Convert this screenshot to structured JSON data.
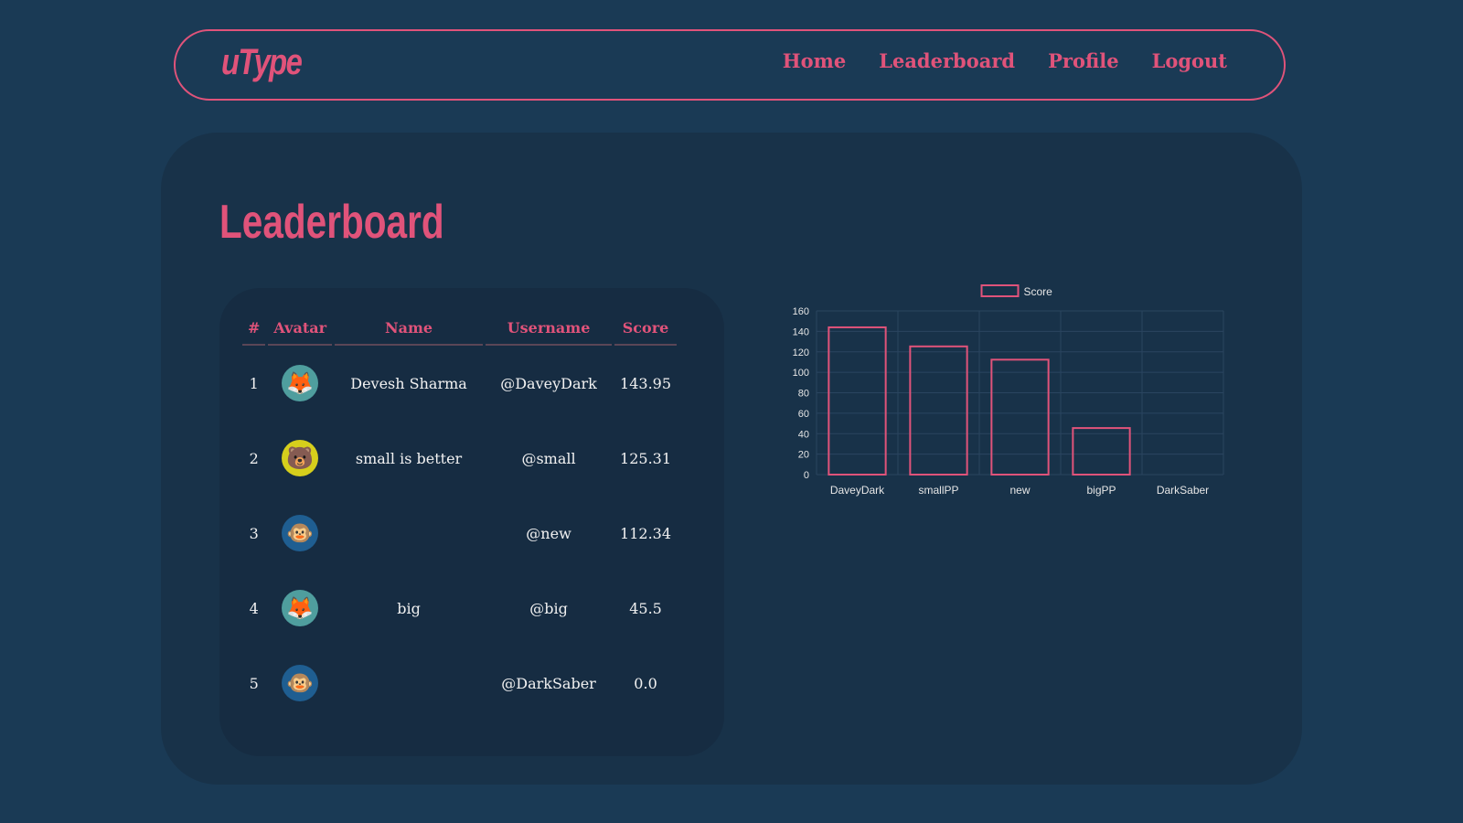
{
  "nav": {
    "logo": "uType",
    "links": [
      "Home",
      "Leaderboard",
      "Profile",
      "Logout"
    ]
  },
  "page": {
    "title": "Leaderboard"
  },
  "table": {
    "headers": [
      "#",
      "Avatar",
      "Name",
      "Username",
      "Score"
    ],
    "rows": [
      {
        "rank": "1",
        "avatar": "fox-icon",
        "avatar_color": "#4f9e9e",
        "name": "Devesh Sharma",
        "username": "@DaveyDark",
        "score": "143.95"
      },
      {
        "rank": "2",
        "avatar": "bear-icon",
        "avatar_color": "#d6cf1c",
        "name": "small is better",
        "username": "@small",
        "score": "125.31"
      },
      {
        "rank": "3",
        "avatar": "monkey-icon",
        "avatar_color": "#1f5e91",
        "name": "",
        "username": "@new",
        "score": "112.34"
      },
      {
        "rank": "4",
        "avatar": "fox-icon",
        "avatar_color": "#4f9e9e",
        "name": "big",
        "username": "@big",
        "score": "45.5"
      },
      {
        "rank": "5",
        "avatar": "monkey-icon",
        "avatar_color": "#1f5e91",
        "name": "",
        "username": "@DarkSaber",
        "score": "0.0"
      }
    ]
  },
  "colors": {
    "accent": "#e0537a",
    "background": "#1a3a55",
    "card": "#183249"
  },
  "chart_data": {
    "type": "bar",
    "categories": [
      "DaveyDark",
      "smallPP",
      "new",
      "bigPP",
      "DarkSaber"
    ],
    "series": [
      {
        "name": "Score",
        "values": [
          143.95,
          125.31,
          112.34,
          45.5,
          0
        ]
      }
    ],
    "ylim": [
      0,
      160
    ],
    "yticks": [
      "0",
      "20",
      "40",
      "60",
      "80",
      "100",
      "120",
      "140",
      "160"
    ],
    "grid": true,
    "legend": "top-center"
  }
}
